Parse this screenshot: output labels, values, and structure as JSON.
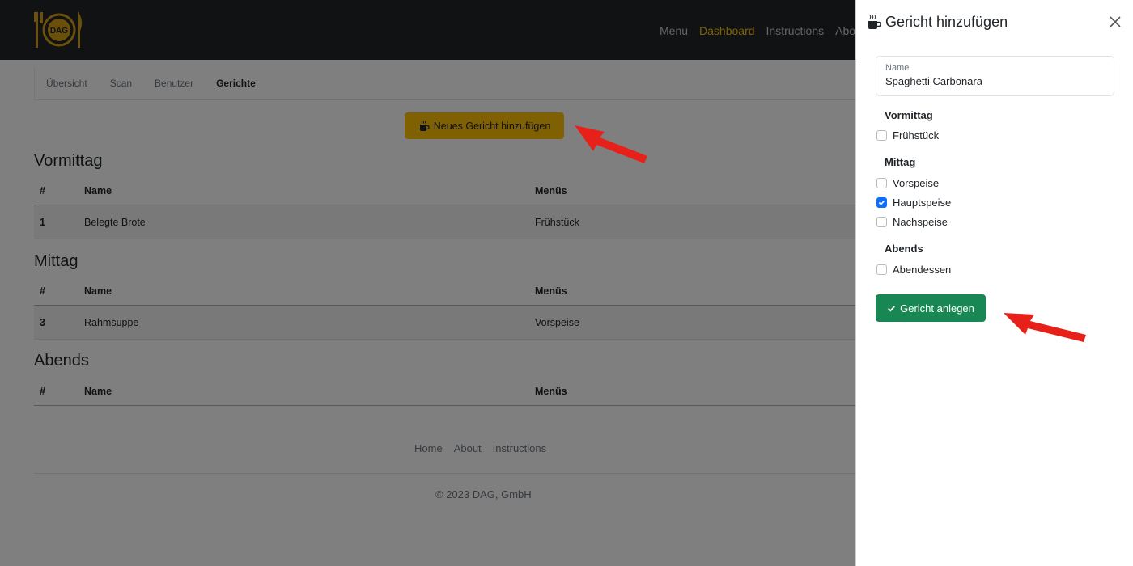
{
  "brand": {
    "logo_text": "DAG"
  },
  "navbar": {
    "items": [
      "Menu",
      "Dashboard",
      "Instructions",
      "About"
    ],
    "active": "Dashboard"
  },
  "subnav": {
    "items": [
      "Übersicht",
      "Scan",
      "Benutzer",
      "Gerichte"
    ],
    "active": "Gerichte"
  },
  "add_button": {
    "label": "Neues Gericht hinzufügen",
    "icon": "mug-hot-icon",
    "color": "#ffc107"
  },
  "table_headers": {
    "number": "#",
    "name": "Name",
    "menus": "Menüs"
  },
  "sections": [
    {
      "title": "Vormittag",
      "rows": [
        {
          "id": "1",
          "name": "Belegte Brote",
          "menus": "Frühstück"
        }
      ]
    },
    {
      "title": "Mittag",
      "rows": [
        {
          "id": "3",
          "name": "Rahmsuppe",
          "menus": "Vorspeise"
        }
      ]
    },
    {
      "title": "Abends",
      "rows": []
    }
  ],
  "footer": {
    "links": [
      "Home",
      "About",
      "Instructions"
    ],
    "copyright": "© 2023 DAG, GmbH"
  },
  "offcanvas": {
    "title": "Gericht hinzufügen",
    "close_icon": "close-icon",
    "name_field": {
      "label": "Name",
      "value": "Spaghetti Carbonara"
    },
    "groups": [
      {
        "title": "Vormittag",
        "options": [
          {
            "label": "Frühstück",
            "checked": false
          }
        ]
      },
      {
        "title": "Mittag",
        "options": [
          {
            "label": "Vorspeise",
            "checked": false
          },
          {
            "label": "Hauptspeise",
            "checked": true
          },
          {
            "label": "Nachspeise",
            "checked": false
          }
        ]
      },
      {
        "title": "Abends",
        "options": [
          {
            "label": "Abendessen",
            "checked": false
          }
        ]
      }
    ],
    "submit_label": "Gericht anlegen",
    "submit_color": "#198754"
  }
}
